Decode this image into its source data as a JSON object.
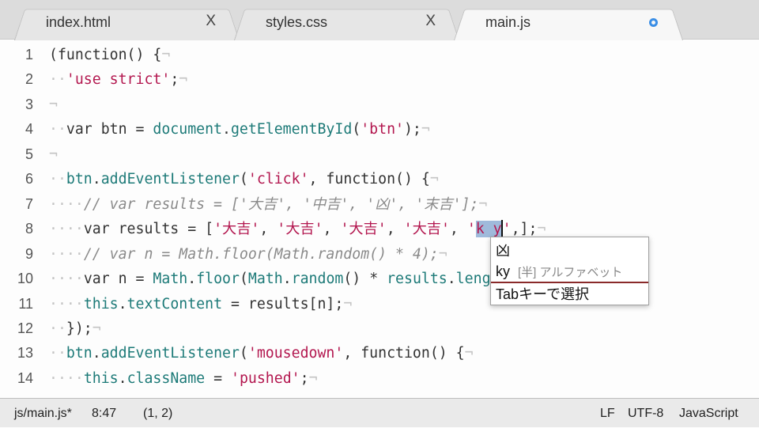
{
  "tabs": [
    {
      "label": "index.html",
      "close": "X",
      "active": false
    },
    {
      "label": "styles.css",
      "close": "X",
      "active": false
    },
    {
      "label": "main.js",
      "active": true,
      "modified": true
    }
  ],
  "accent": "#3a8ee6",
  "lines": [
    [
      [
        "p",
        "(function() {"
      ],
      [
        "i",
        "¬"
      ]
    ],
    [
      [
        "i",
        "··"
      ],
      [
        "s",
        "'use strict'"
      ],
      [
        "p",
        ";"
      ],
      [
        "i",
        "¬"
      ]
    ],
    [
      [
        "i",
        "¬"
      ]
    ],
    [
      [
        "i",
        "··"
      ],
      [
        "p",
        "var btn = "
      ],
      [
        "t",
        "document"
      ],
      [
        "p",
        "."
      ],
      [
        "t",
        "getElementById"
      ],
      [
        "p",
        "("
      ],
      [
        "s",
        "'btn'"
      ],
      [
        "p",
        ");"
      ],
      [
        "i",
        "¬"
      ]
    ],
    [
      [
        "i",
        "¬"
      ]
    ],
    [
      [
        "i",
        "··"
      ],
      [
        "t",
        "btn"
      ],
      [
        "p",
        "."
      ],
      [
        "t",
        "addEventListener"
      ],
      [
        "p",
        "("
      ],
      [
        "s",
        "'click'"
      ],
      [
        "p",
        ", function() {"
      ],
      [
        "i",
        "¬"
      ]
    ],
    [
      [
        "i",
        "····"
      ],
      [
        "c",
        "// var results = ['大吉', '中吉', '凶', '末吉'];"
      ],
      [
        "i",
        "¬"
      ]
    ],
    [
      [
        "i",
        "····"
      ],
      [
        "p",
        "var results = ["
      ],
      [
        "s",
        "'大吉'"
      ],
      [
        "p",
        ", "
      ],
      [
        "s",
        "'大吉'"
      ],
      [
        "p",
        ", "
      ],
      [
        "s",
        "'大吉'"
      ],
      [
        "p",
        ", "
      ],
      [
        "s",
        "'大吉'"
      ],
      [
        "p",
        ", "
      ],
      [
        "s",
        "'"
      ],
      [
        "m",
        "k y"
      ],
      [
        "cur",
        ""
      ],
      [
        "s",
        "'"
      ],
      [
        "p",
        ",];"
      ],
      [
        "i",
        "¬"
      ]
    ],
    [
      [
        "i",
        "····"
      ],
      [
        "c",
        "// var n = Math.floor(Math.random() * 4);"
      ],
      [
        "i",
        "¬"
      ]
    ],
    [
      [
        "i",
        "····"
      ],
      [
        "p",
        "var n = "
      ],
      [
        "t",
        "Math"
      ],
      [
        "p",
        "."
      ],
      [
        "t",
        "floor"
      ],
      [
        "p",
        "("
      ],
      [
        "t",
        "Math"
      ],
      [
        "p",
        "."
      ],
      [
        "t",
        "random"
      ],
      [
        "p",
        "() * "
      ],
      [
        "t",
        "results"
      ],
      [
        "p",
        "."
      ],
      [
        "t",
        "length"
      ],
      [
        "p",
        ");"
      ]
    ],
    [
      [
        "i",
        "····"
      ],
      [
        "t",
        "this"
      ],
      [
        "p",
        "."
      ],
      [
        "t",
        "textContent"
      ],
      [
        "p",
        " = results[n];"
      ],
      [
        "i",
        "¬"
      ]
    ],
    [
      [
        "i",
        "··"
      ],
      [
        "p",
        "});"
      ],
      [
        "i",
        "¬"
      ]
    ],
    [
      [
        "i",
        "··"
      ],
      [
        "t",
        "btn"
      ],
      [
        "p",
        "."
      ],
      [
        "t",
        "addEventListener"
      ],
      [
        "p",
        "("
      ],
      [
        "s",
        "'mousedown'"
      ],
      [
        "p",
        ", function() {"
      ],
      [
        "i",
        "¬"
      ]
    ],
    [
      [
        "i",
        "····"
      ],
      [
        "t",
        "this"
      ],
      [
        "p",
        "."
      ],
      [
        "t",
        "className"
      ],
      [
        "p",
        " = "
      ],
      [
        "s",
        "'pushed'"
      ],
      [
        "p",
        ";"
      ],
      [
        "i",
        "¬"
      ]
    ]
  ],
  "ime": {
    "candidates": [
      {
        "text": "凶",
        "note": ""
      },
      {
        "text": "ky",
        "note": "[半] アルファベット"
      }
    ],
    "hint": "Tabキーで選択"
  },
  "status": {
    "file": "js/main.js*",
    "cursor": "8:47",
    "selection": "(1, 2)",
    "line_ending": "LF",
    "encoding": "UTF-8",
    "grammar": "JavaScript"
  }
}
